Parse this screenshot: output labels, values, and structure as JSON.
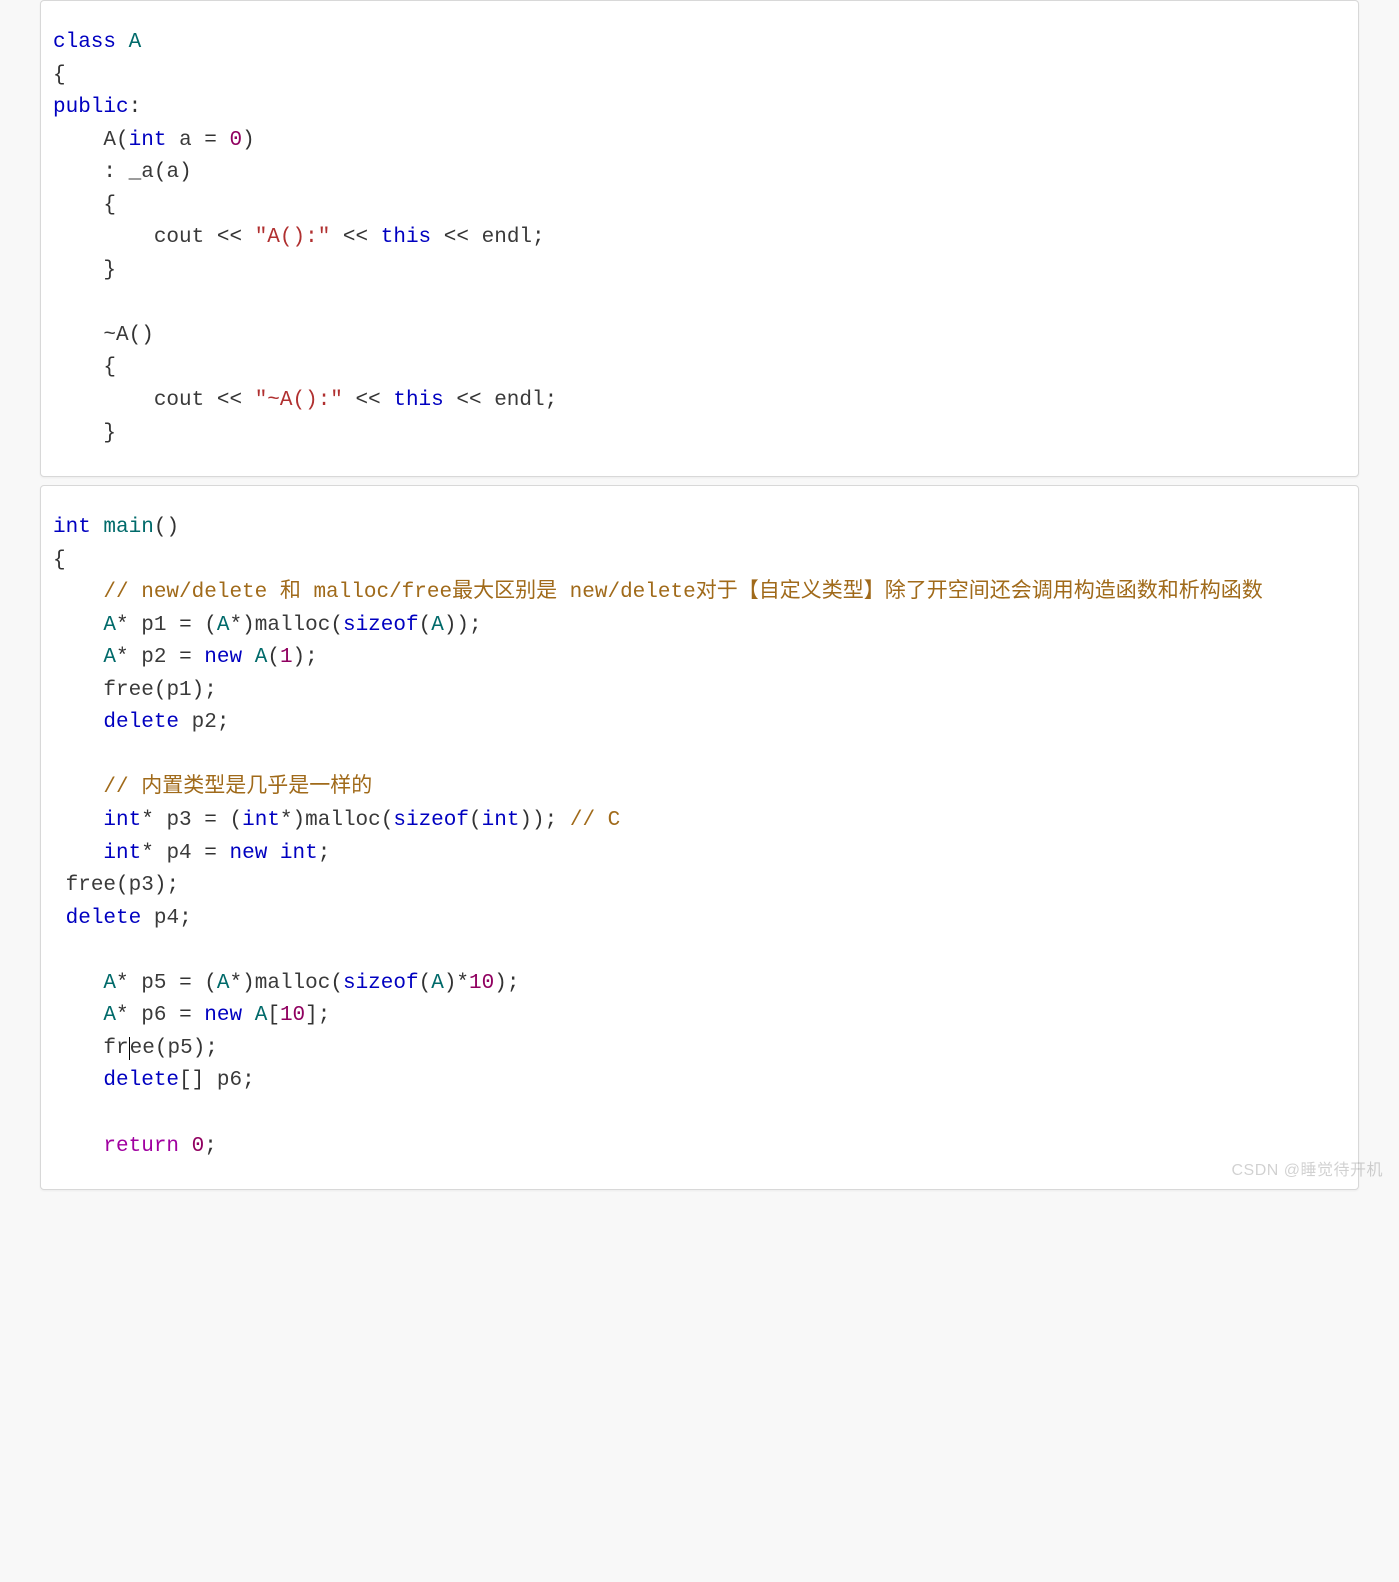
{
  "watermark": "CSDN @睡觉待开机",
  "block1": {
    "l1": {
      "kw_class": "class",
      "sp": " ",
      "name": "A"
    },
    "l2": "{",
    "l3": {
      "kw_public": "public",
      "colon": ":"
    },
    "l4": {
      "indent": "    ",
      "name": "A",
      "lp": "(",
      "kw_int": "int",
      "sp1": " ",
      "arg": "a",
      "sp2": " ",
      "eq": "=",
      "sp3": " ",
      "num": "0",
      "rp": ")"
    },
    "l5": {
      "indent": "    ",
      "colon": ":",
      "sp": " ",
      "mem": "_a",
      "lp": "(",
      "arg": "a",
      "rp": ")"
    },
    "l6": {
      "indent": "    ",
      "brace": "{"
    },
    "l7": {
      "indent": "        ",
      "cout": "cout",
      "sp1": " ",
      "op1": "<<",
      "sp2": " ",
      "str": "\"A():\"",
      "sp3": " ",
      "op2": "<<",
      "sp4": " ",
      "this": "this",
      "sp5": " ",
      "op3": "<<",
      "sp6": " ",
      "endl": "endl",
      "semi": ";"
    },
    "l8": {
      "indent": "    ",
      "brace": "}"
    },
    "l9": "",
    "l10": {
      "indent": "    ",
      "tilde": "~",
      "name": "A",
      "lp": "(",
      "rp": ")"
    },
    "l11": {
      "indent": "    ",
      "brace": "{"
    },
    "l12": {
      "indent": "        ",
      "cout": "cout",
      "sp1": " ",
      "op1": "<<",
      "sp2": " ",
      "str": "\"~A():\"",
      "sp3": " ",
      "op2": "<<",
      "sp4": " ",
      "this": "this",
      "sp5": " ",
      "op3": "<<",
      "sp6": " ",
      "endl": "endl",
      "semi": ";"
    },
    "l13": {
      "indent": "    ",
      "brace": "}"
    }
  },
  "block2": {
    "l1": {
      "kw_int": "int",
      "sp": " ",
      "name": "main",
      "lp": "(",
      "rp": ")"
    },
    "l2": "{",
    "l3": {
      "indent": "    ",
      "cmnt": "// new/delete 和 malloc/free最大区别是 new/delete对于【自定义类型】除了开空间还会调用构造函数和析构函数"
    },
    "l4": {
      "indent": "    ",
      "type": "A",
      "star": "*",
      "sp1": " ",
      "var": "p1",
      "sp2": " ",
      "eq": "=",
      "sp3": " ",
      "lp1": "(",
      "cast": "A",
      "cstar": "*",
      "rp1": ")",
      "fn": "malloc",
      "lp2": "(",
      "sizeof": "sizeof",
      "lp3": "(",
      "of": "A",
      "rp3": ")",
      "rp2": ")",
      "semi": ";"
    },
    "l5": {
      "indent": "    ",
      "type": "A",
      "star": "*",
      "sp1": " ",
      "var": "p2",
      "sp2": " ",
      "eq": "=",
      "sp3": " ",
      "kw_new": "new",
      "sp4": " ",
      "cls": "A",
      "lp": "(",
      "num": "1",
      "rp": ")",
      "semi": ";"
    },
    "l6": {
      "indent": "    ",
      "fn": "free",
      "lp": "(",
      "arg": "p1",
      "rp": ")",
      "semi": ";"
    },
    "l7": {
      "indent": "    ",
      "kw_delete": "delete",
      "sp": " ",
      "arg": "p2",
      "semi": ";"
    },
    "l8": "",
    "l9": {
      "indent": "    ",
      "cmnt": "// 内置类型是几乎是一样的"
    },
    "l10": {
      "indent": "    ",
      "kw_int": "int",
      "star": "*",
      "sp1": " ",
      "var": "p3",
      "sp2": " ",
      "eq": "=",
      "sp3": " ",
      "lp1": "(",
      "cast": "int",
      "cstar": "*",
      "rp1": ")",
      "fn": "malloc",
      "lp2": "(",
      "sizeof": "sizeof",
      "lp3": "(",
      "of": "int",
      "rp3": ")",
      "rp2": ")",
      "semi": ";",
      "sp4": " ",
      "cmnt": "// C"
    },
    "l11": {
      "indent": "    ",
      "kw_int": "int",
      "star": "*",
      "sp1": " ",
      "var": "p4",
      "sp2": " ",
      "eq": "=",
      "sp3": " ",
      "kw_new": "new",
      "sp4": " ",
      "of": "int",
      "semi": ";"
    },
    "l12": {
      "indent": " ",
      "fn": "free",
      "lp": "(",
      "arg": "p3",
      "rp": ")",
      "semi": ";"
    },
    "l13": {
      "indent": " ",
      "kw_delete": "delete",
      "sp": " ",
      "arg": "p4",
      "semi": ";"
    },
    "l14": "",
    "l15": {
      "indent": "    ",
      "type": "A",
      "star": "*",
      "sp1": " ",
      "var": "p5",
      "sp2": " ",
      "eq": "=",
      "sp3": " ",
      "lp1": "(",
      "cast": "A",
      "cstar": "*",
      "rp1": ")",
      "fn": "malloc",
      "lp2": "(",
      "sizeof": "sizeof",
      "lp3": "(",
      "of": "A",
      "rp3": ")",
      "mul": "*",
      "num": "10",
      "rp2": ")",
      "semi": ";"
    },
    "l16": {
      "indent": "    ",
      "type": "A",
      "star": "*",
      "sp1": " ",
      "var": "p6",
      "sp2": " ",
      "eq": "=",
      "sp3": " ",
      "kw_new": "new",
      "sp4": " ",
      "cls": "A",
      "lb": "[",
      "num": "10",
      "rb": "]",
      "semi": ";"
    },
    "l17": {
      "indent": "    ",
      "fn_a": "fr",
      "fn_b": "ee",
      "lp": "(",
      "arg": "p5",
      "rp": ")",
      "semi": ";"
    },
    "l18": {
      "indent": "    ",
      "kw_delete": "delete",
      "brk": "[]",
      "sp": " ",
      "arg": "p6",
      "semi": ";"
    },
    "l19": "",
    "l20": {
      "indent": "    ",
      "kw_return": "return",
      "sp": " ",
      "num": "0",
      "semi": ";"
    }
  }
}
